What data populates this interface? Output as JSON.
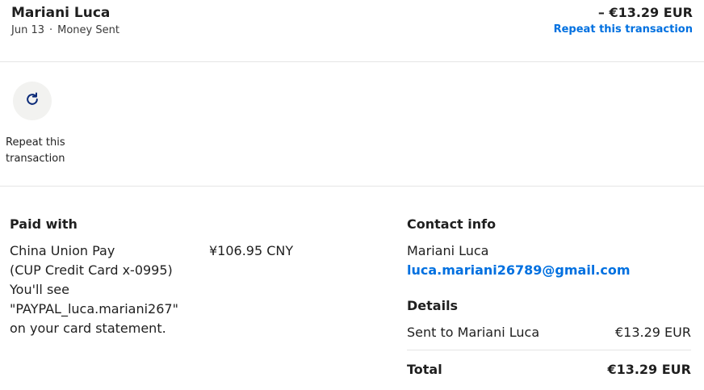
{
  "header": {
    "name": "Mariani Luca",
    "date": "Jun 13",
    "separator": "·",
    "type": "Money Sent",
    "amount": "– €13.29 EUR",
    "repeat_link": "Repeat this transaction"
  },
  "actions": {
    "repeat_label": "Repeat this transaction",
    "repeat_icon": "refresh-icon"
  },
  "paid_with": {
    "title": "Paid with",
    "method_line1": "China Union Pay",
    "method_line2": "(CUP Credit Card x-0995)",
    "statement_note": "You'll see \"PAYPAL_luca.mariani267\" on your card statement.",
    "amount": "¥106.95 CNY"
  },
  "contact": {
    "title": "Contact info",
    "name": "Mariani Luca",
    "email": "luca.mariani26789@gmail.com"
  },
  "details": {
    "title": "Details",
    "sent_label": "Sent to Mariani Luca",
    "sent_amount": "€13.29 EUR",
    "total_label": "Total",
    "total_amount": "€13.29 EUR"
  },
  "colors": {
    "link": "#0070e0",
    "divider": "#e5e5e5",
    "icon_bg": "#f2f2f0"
  }
}
